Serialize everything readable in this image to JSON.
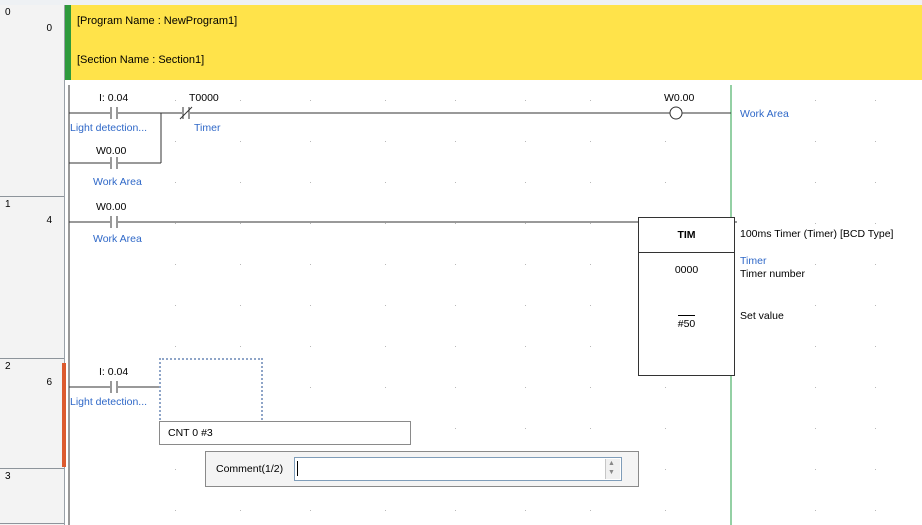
{
  "header": {
    "program_name": "[Program Name : NewProgram1]",
    "section_name": "[Section Name : Section1]"
  },
  "rungs": [
    {
      "index": "0",
      "step": "0"
    },
    {
      "index": "1",
      "step": "4"
    },
    {
      "index": "2",
      "step": "6"
    },
    {
      "index": "3",
      "step": ""
    }
  ],
  "rung0": {
    "contact1_address": "I: 0.04",
    "contact1_comment": "Light detection...",
    "contact2_address": "T0000",
    "contact2_comment": "Timer",
    "contact3_address": "W0.00",
    "contact3_comment": "Work Area",
    "coil_address": "W0.00",
    "coil_comment": "Work Area"
  },
  "rung1": {
    "contact_address": "W0.00",
    "contact_comment": "Work Area",
    "instruction": "TIM",
    "instruction_desc": "100ms Timer (Timer) [BCD Type]",
    "timer_number": "0000",
    "timer_comment": "Timer",
    "timer_number_label": "Timer number",
    "set_value": "#50",
    "set_value_label": "Set value"
  },
  "rung2": {
    "contact_address": "I: 0.04",
    "contact_comment": "Light detection...",
    "instruction_input": "CNT 0 #3",
    "comment_label": "Comment(1/2)",
    "comment_value": ""
  },
  "colors": {
    "header_bg": "#ffe34a",
    "header_bar": "#2e9a3c",
    "comment_text": "#2f68c8",
    "right_rail": "#2aa24a",
    "active_rung_marker": "#dc5a2e"
  }
}
